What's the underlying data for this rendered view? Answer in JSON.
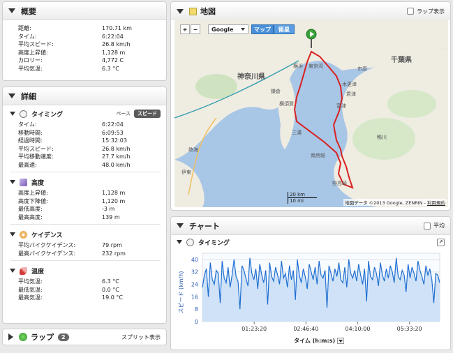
{
  "summary": {
    "title": "概要",
    "rows": [
      {
        "label": "距離:",
        "value": "170.71 km"
      },
      {
        "label": "タイム:",
        "value": "6:22:04"
      },
      {
        "label": "平均スピード:",
        "value": "26.8 km/h"
      },
      {
        "label": "高度上昇値:",
        "value": "1,128 m"
      },
      {
        "label": "カロリー:",
        "value": "4,772 C"
      },
      {
        "label": "平均気温:",
        "value": "6.3 °C"
      }
    ]
  },
  "details": {
    "title": "詳細",
    "timing": {
      "title": "タイミング",
      "toggle_pace": "ペース",
      "toggle_speed": "スピード",
      "rows": [
        {
          "label": "タイム:",
          "value": "6:22:04"
        },
        {
          "label": "移動時間:",
          "value": "6:09:53"
        },
        {
          "label": "経過時間:",
          "value": "15:32:03"
        },
        {
          "label": "平均スピード:",
          "value": "26.8 km/h"
        },
        {
          "label": "平均移動速度:",
          "value": "27.7 km/h"
        },
        {
          "label": "最高速:",
          "value": "48.0 km/h"
        }
      ]
    },
    "elevation": {
      "title": "高度",
      "rows": [
        {
          "label": "高度上昇値:",
          "value": "1,128 m"
        },
        {
          "label": "高度下降値:",
          "value": "1,120 m"
        },
        {
          "label": "最低高度:",
          "value": "-3 m"
        },
        {
          "label": "最高高度:",
          "value": "139 m"
        }
      ]
    },
    "cadence": {
      "title": "ケイデンス",
      "rows": [
        {
          "label": "平均バイクケイデンス:",
          "value": "79 rpm"
        },
        {
          "label": "最高バイクケイデンス:",
          "value": "232 rpm"
        }
      ]
    },
    "temperature": {
      "title": "温度",
      "rows": [
        {
          "label": "平均気温:",
          "value": "6.3 °C"
        },
        {
          "label": "最低気温:",
          "value": "0.0 °C"
        },
        {
          "label": "最高気温:",
          "value": "19.0 °C"
        }
      ]
    }
  },
  "laps": {
    "title": "ラップ",
    "count": "2",
    "split_label": "スプリット表示"
  },
  "map": {
    "title": "地図",
    "lap_display": "ラップ表示",
    "provider": "Google",
    "type_map": "マップ",
    "type_satellite": "衛星",
    "zoom_in": "+",
    "zoom_out": "−",
    "scale_km": "20 km",
    "scale_mi": "10 mi",
    "attribution": "地図データ ©2013 Google, ZENRIN - ",
    "terms": "利用規約",
    "labels": {
      "kanagawa": "神奈川県",
      "chiba": "千葉県",
      "tokyo_station": "東京湾",
      "yokohama": "横浜",
      "yokosuka": "横須賀",
      "kamakura": "鎌倉",
      "miura": "三浦",
      "atami": "熱海",
      "futtsu": "富津",
      "kimitsu": "君津",
      "kisarazu": "木更津",
      "tateyama": "南房総",
      "nojima": "野島崎",
      "kamogawa": "鴨川",
      "ichihara": "市原",
      "ito": "伊東"
    }
  },
  "chart": {
    "title": "チャート",
    "average_label": "平均",
    "timing_title": "タイミング",
    "x_select": "タイム (h:m:s)"
  },
  "chart_data": {
    "type": "area",
    "title": "",
    "xlabel": "タイム (h:m:s)",
    "ylabel": "スピード (km/h)",
    "ylim": [
      0,
      44
    ],
    "xlim": [
      0,
      22924
    ],
    "y_ticks": [
      0,
      8,
      16,
      24,
      32,
      40
    ],
    "x_ticks": [
      "01:23:20",
      "02:46:40",
      "04:10:00",
      "05:33:20"
    ],
    "x_tick_seconds": [
      5000,
      10000,
      15000,
      20000
    ],
    "series": [
      {
        "values": [
          22,
          30,
          34,
          16,
          38,
          27,
          24,
          33,
          31,
          12,
          39,
          28,
          25,
          35,
          22,
          30,
          40,
          29,
          26,
          8,
          36,
          33,
          28,
          23,
          41,
          31,
          27,
          34,
          21,
          37,
          30,
          25,
          33,
          11,
          38,
          29,
          26,
          35,
          30,
          24,
          39,
          28,
          31,
          22,
          36,
          27,
          33,
          14,
          40,
          30,
          25,
          34,
          29,
          21,
          37,
          32,
          27,
          35,
          24,
          39,
          30,
          28,
          33,
          9,
          36,
          31,
          26,
          34,
          29,
          38,
          27,
          25,
          35,
          22,
          40,
          31,
          28,
          33,
          26,
          37,
          30,
          24,
          34,
          13,
          39,
          29,
          27,
          35,
          31,
          23,
          38,
          30,
          26,
          34,
          28,
          36,
          32,
          25,
          41,
          29,
          27,
          33,
          30,
          19,
          37,
          28,
          35,
          31,
          26,
          39,
          33,
          29,
          24,
          36,
          30,
          34,
          27,
          12,
          31,
          30,
          25
        ]
      }
    ],
    "colors": {
      "line": "#1f6fd1",
      "fill": "#cfe2f7"
    }
  }
}
